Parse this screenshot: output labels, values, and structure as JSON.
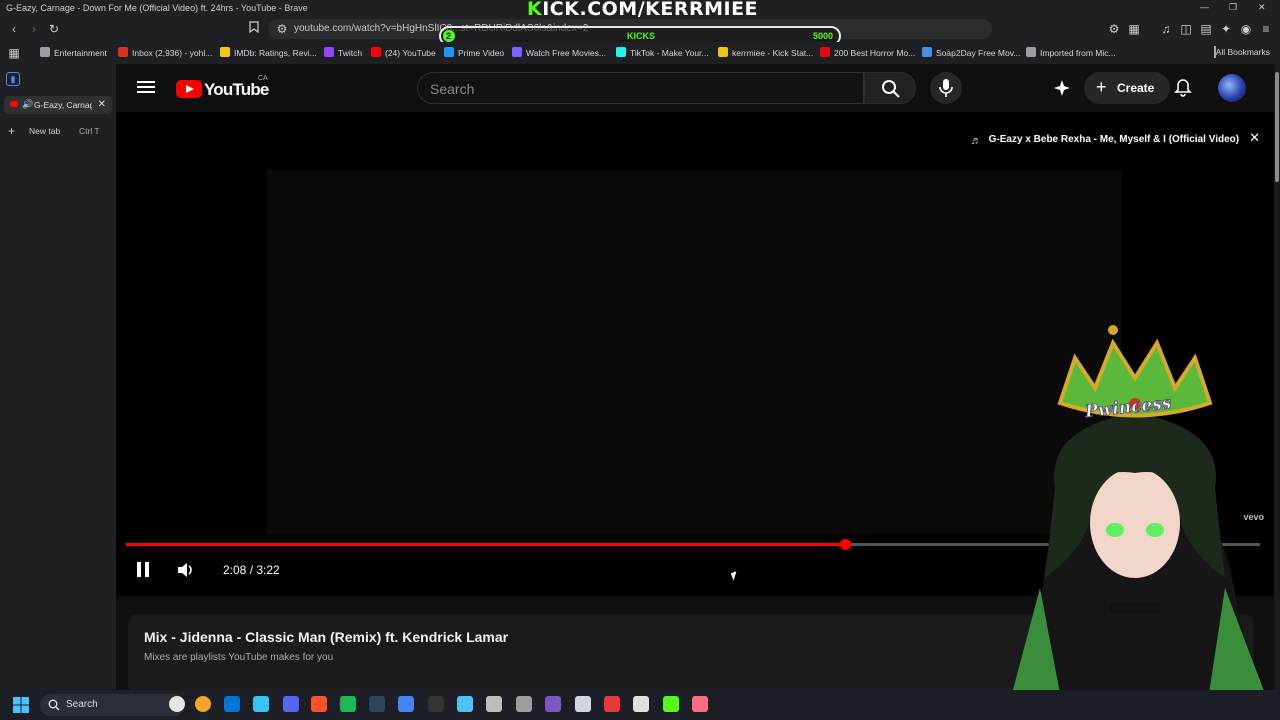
{
  "window": {
    "title": "G-Eazy, Carnage - Down For Me (Official Video) ft. 24hrs - YouTube - Brave",
    "minimize": "—",
    "restore": "❐",
    "close": "✕"
  },
  "overlay": {
    "banner_k": "K",
    "banner_rest": "ICK.COM/KERRMIEE",
    "kicks_count": "2",
    "kicks_label": "KICKS",
    "kicks_goal": "5000",
    "kicks_progress_fraction": 0.0004,
    "vtuber_badge": "Pwincess"
  },
  "browser": {
    "url": "youtube.com/watch?v=bHgHnSlIC8...st=RDURiDdlAS6ls&index=2"
  },
  "bookmarks": [
    {
      "label": "Entertainment",
      "color": "#9aa0a6"
    },
    {
      "label": "Inbox (2,936) - yohl...",
      "color": "#d93025"
    },
    {
      "label": "IMDb: Ratings, Revi...",
      "color": "#f5c518"
    },
    {
      "label": "Twitch",
      "color": "#9146ff"
    },
    {
      "label": "(24) YouTube",
      "color": "#ff0000"
    },
    {
      "label": "Prime Video",
      "color": "#1a98ff"
    },
    {
      "label": "Watch Free Movies...",
      "color": "#7b61ff"
    },
    {
      "label": "TikTok - Make Your...",
      "color": "#25f4ee"
    },
    {
      "label": "kerrmiee - Kick Stat...",
      "color": "#f1c40f"
    },
    {
      "label": "200 Best Horror Mo...",
      "color": "#e50914"
    },
    {
      "label": "Soap2Day Free Mov...",
      "color": "#4a90e2"
    },
    {
      "label": "Imported from Mic...",
      "color": "#9aa0a6"
    }
  ],
  "all_bookmarks": "All Bookmarks",
  "tabs": {
    "active_title": "G-Eazy, Carnage",
    "new_tab": "New tab",
    "new_tab_shortcut": "Ctrl T"
  },
  "youtube": {
    "logo": "YouTube",
    "country": "CA",
    "search_placeholder": "Search",
    "create_label": "Create"
  },
  "player": {
    "up_next": "G-Eazy x Bebe Rexha - Me, Myself & I (Official Video)",
    "current_time": "2:08 / 3:22",
    "progress_fraction": 0.634,
    "watermark": "vevo"
  },
  "mix": {
    "title": "Mix - Jidenna - Classic Man (Remix) ft. Kendrick Lamar",
    "subtitle": "Mixes are playlists YouTube makes for you"
  },
  "taskbar": {
    "search_label": "Search",
    "app_colors": [
      "#e5e5e5",
      "#f5a623",
      "#0078d4",
      "#35c4f4",
      "#5865f2",
      "#fb542b",
      "#1db954",
      "#2a475e",
      "#4285f4",
      "#333333",
      "#4fc3f7",
      "#bdbdbd",
      "#9e9e9e",
      "#7e57c2",
      "#cfd8dc",
      "#e53935",
      "#e0e0e0",
      "#53fc18",
      "#ff6b81"
    ]
  }
}
